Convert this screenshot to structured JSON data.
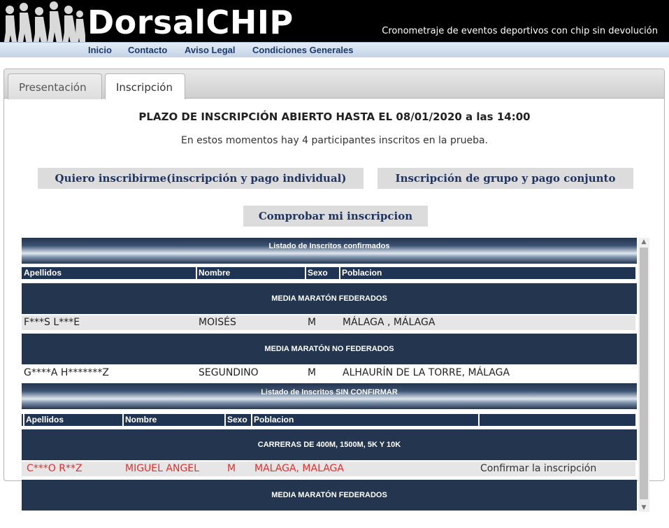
{
  "header": {
    "brand": "DorsalCHIP",
    "tagline": "Cronometraje de eventos deportivos con chip sin devolución",
    "nav": [
      "Inicio",
      "Contacto",
      "Aviso Legal",
      "Condiciones Generales"
    ]
  },
  "tabs": [
    {
      "label": "Presentación",
      "active": false
    },
    {
      "label": "Inscripción",
      "active": true
    }
  ],
  "main": {
    "deadline": "PLAZO DE INSCRIPCIÓN ABIERTO HASTA EL 08/01/2020 a las 14:00",
    "count_text": "En estos momentos hay 4 participantes inscritos en la prueba.",
    "btn_individual": "Quiero inscribirme(inscripción y pago individual)",
    "btn_group": "Inscripción de grupo y pago conjunto",
    "btn_check": "Comprobar mi inscripcion"
  },
  "confirmed": {
    "title": "Listado de Inscritos confirmados",
    "headers": [
      "Apellidos",
      "Nombre",
      "Sexo",
      "Poblacion"
    ],
    "cat1": "MEDIA MARATÓN FEDERADOS",
    "row1": [
      "F***S L***E",
      "MOISÉS",
      "M",
      "MÁLAGA , MÁLAGA"
    ],
    "cat2": "MEDIA MARATÓN NO FEDERADOS",
    "row2": [
      "G****A H*******Z",
      "SEGUNDINO",
      "M",
      "ALHAURÍN DE LA TORRE, MÁLAGA"
    ]
  },
  "unconfirmed": {
    "title": "Listado de Inscritos SIN CONFIRMAR",
    "headers": [
      "Apellidos",
      "Nombre",
      "Sexo",
      "Poblacion"
    ],
    "cat1": "CARRERAS DE 400M, 1500M, 5K Y 10K",
    "row1": [
      "C***O R**Z",
      "MIGUEL ANGEL",
      "M",
      "MALAGA, MALAGA",
      "Confirmar la inscripción"
    ],
    "cat2": "MEDIA MARATÓN FEDERADOS"
  },
  "colors": {
    "header_bg": "#000000",
    "nav_text": "#1b3a6b",
    "table_dark": "#24364f",
    "unconfirmed_text": "#e03030"
  }
}
